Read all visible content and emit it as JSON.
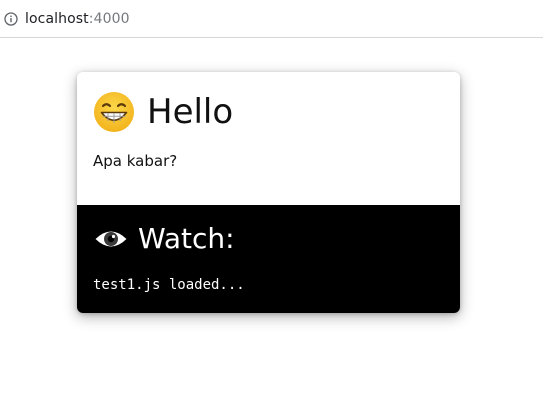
{
  "browser": {
    "url_host": "localhost",
    "url_port": ":4000",
    "info_icon": "info-icon"
  },
  "card": {
    "hello": {
      "icon": "grinning-face-icon",
      "title": "Hello",
      "message": "Apa kabar?"
    },
    "watch": {
      "icon": "eye-icon",
      "title": "Watch:",
      "log": "test1.js loaded..."
    }
  },
  "colors": {
    "watch_background": "#000000",
    "card_background": "#ffffff",
    "url_port": "#75797e"
  }
}
